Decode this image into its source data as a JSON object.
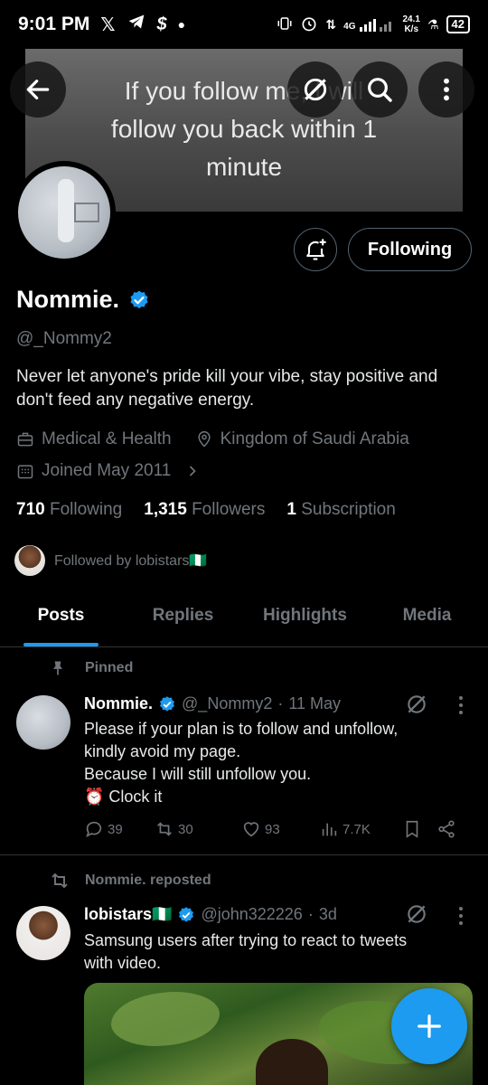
{
  "status_bar": {
    "time": "9:01 PM",
    "icons": [
      "x-logo-icon",
      "telegram-icon",
      "dollar-s-icon",
      "dot-icon"
    ],
    "speed_value": "24.1",
    "speed_unit": "K/s",
    "network": "4G",
    "battery": "42"
  },
  "banner": {
    "text_line1": "If you follow me, I will",
    "text_line2": "follow you back within 1",
    "text_line3": "minute"
  },
  "header_buttons": [
    "back-arrow-icon",
    "grok-icon",
    "search-icon",
    "more-vertical-icon"
  ],
  "profile": {
    "name": "Nommie.",
    "handle": "@_Nommy2",
    "bio": "Never let anyone's pride kill your vibe, stay positive and don't feed any negative energy.",
    "category": "Medical & Health",
    "location": "Kingdom of Saudi Arabia",
    "joined": "Joined May 2011",
    "following_count": "710",
    "following_label": "Following",
    "followers_count": "1,315",
    "followers_label": "Followers",
    "subscription_count": "1",
    "subscription_label": "Subscription",
    "followed_by": "Followed by lobistars🇳🇬",
    "following_button": "Following"
  },
  "tabs": [
    "Posts",
    "Replies",
    "Highlights",
    "Media"
  ],
  "posts": [
    {
      "context": "Pinned",
      "name": "Nommie.",
      "handle": "@_Nommy2",
      "date": "11 May",
      "text_line1": "Please if your plan is to follow and unfollow,",
      "text_line2": "kindly avoid my page.",
      "text_line3": "Because I will still unfollow you.",
      "text_line4": "⏰ Clock it",
      "replies": "39",
      "reposts": "30",
      "likes": "93",
      "views": "7.7K"
    },
    {
      "context": "Nommie. reposted",
      "name": "lobistars🇳🇬",
      "handle": "@john322226",
      "date": "3d",
      "text_line1": "Samsung users after trying to react to tweets",
      "text_line2": "with video."
    }
  ],
  "colors": {
    "accent": "#1d9bf0",
    "muted": "#71767b",
    "divider": "#2f3336",
    "text": "#e7e9ea"
  }
}
